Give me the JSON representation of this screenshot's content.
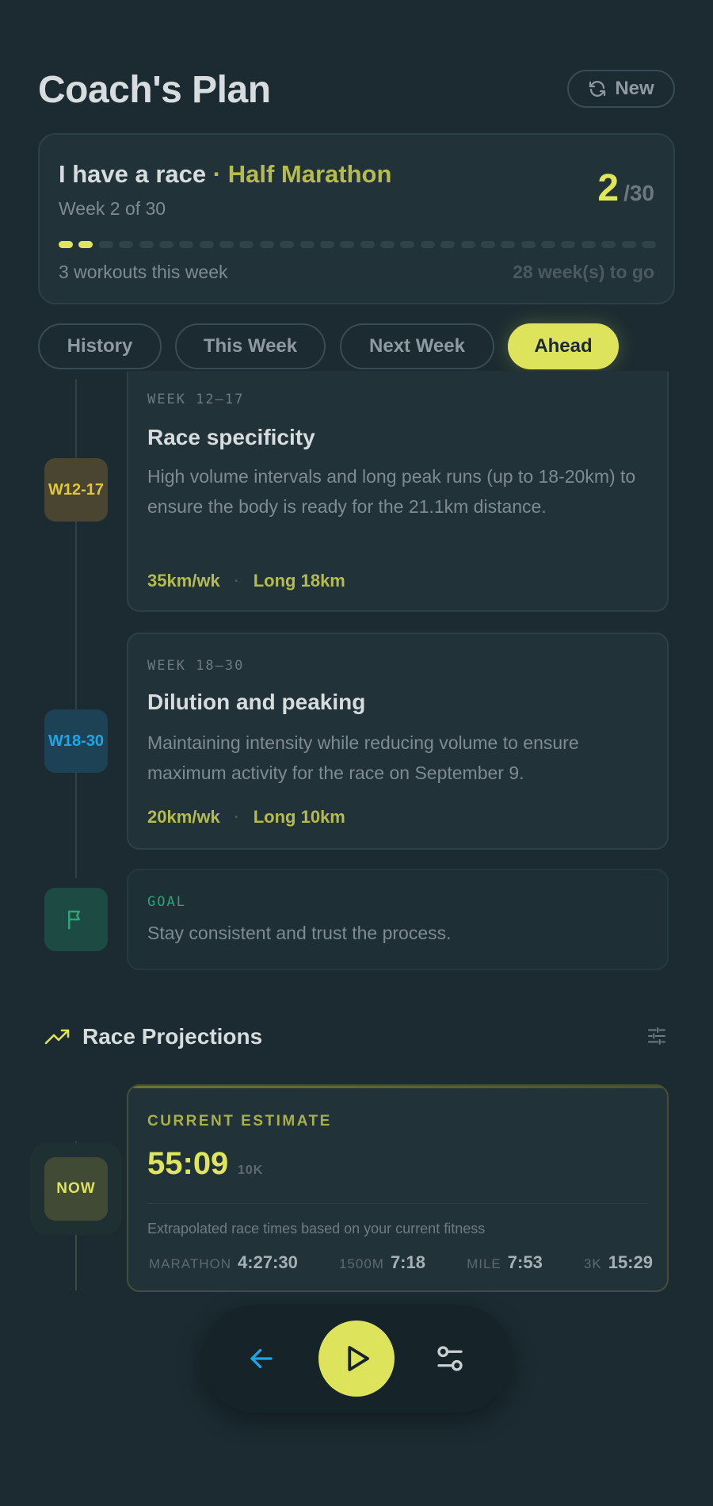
{
  "header": {
    "title": "Coach's Plan",
    "new_label": "New"
  },
  "race": {
    "title_prefix": "I have a race",
    "separator": " · ",
    "race_name": "Half Marathon",
    "week_text": "Week 2 of 30",
    "current_week": "2",
    "total_weeks": "/30",
    "weeks_completed_fraction": 0.0667,
    "workouts_text": "3 workouts this week",
    "to_go_text": "28 week(s) to go"
  },
  "tabs": [
    {
      "label": "History",
      "active": false
    },
    {
      "label": "This Week",
      "active": false
    },
    {
      "label": "Next Week",
      "active": false
    },
    {
      "label": "Ahead",
      "active": true
    }
  ],
  "phases": [
    {
      "badge": "W12-17",
      "label": "WEEK 12–17",
      "title": "Race specificity",
      "description": "High volume intervals and long peak runs (up to 18-20km) to ensure the body is ready for the 21.1km distance.",
      "stat_volume": "35km/wk",
      "stat_long": "Long 18km"
    },
    {
      "badge": "W18-30",
      "label": "WEEK 18–30",
      "title": "Dilution and peaking",
      "description": "Maintaining intensity while reducing volume to ensure maximum activity for the race on September 9.",
      "stat_volume": "20km/wk",
      "stat_long": "Long 10km"
    }
  ],
  "goal": {
    "label": "GOAL",
    "text": "Stay consistent and trust the process."
  },
  "projections": {
    "title": "Race Projections",
    "now_badge": "NOW",
    "estimate_label": "CURRENT ESTIMATE",
    "estimate_time": "55:09",
    "estimate_distance": "10K",
    "note": "Extrapolated race times based on your current fitness",
    "items": [
      {
        "distance": "MARATHON",
        "time": "4:27:30"
      },
      {
        "distance": "1500M",
        "time": "7:18"
      },
      {
        "distance": "MILE",
        "time": "7:53"
      },
      {
        "distance": "3K",
        "time": "15:29"
      }
    ]
  },
  "colors": {
    "accent": "#dde35a",
    "olive": "#b5bb4e",
    "blue": "#1aa7e6",
    "green": "#2fa37a"
  },
  "icons": {
    "new": "refresh-icon",
    "goal": "flag-icon",
    "projections": "trending-up-icon",
    "filter": "sliders-icon",
    "back": "arrow-left-icon",
    "play": "play-icon",
    "settings": "settings-icon"
  }
}
